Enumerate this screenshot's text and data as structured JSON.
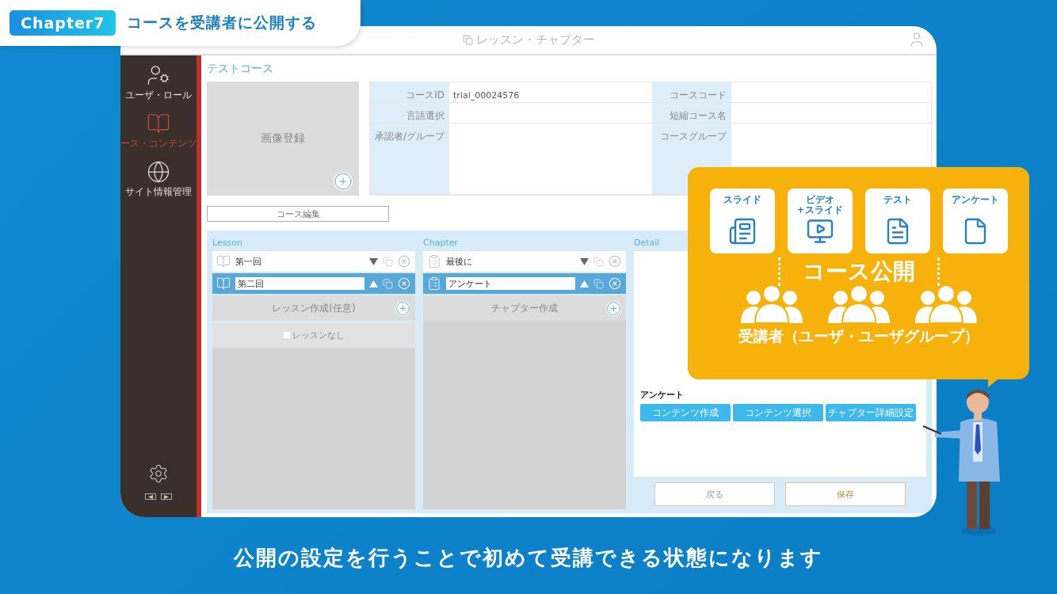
{
  "header": {
    "chapter_badge": "Chapter7",
    "title": "コースを受講者に公開する"
  },
  "window": {
    "title": "レッスン・チャプター"
  },
  "sidebar": {
    "items": [
      {
        "label": "ユーザ・ロール",
        "selected": false
      },
      {
        "label": "ース・コンテンツ",
        "selected": true
      },
      {
        "label": "サイト情報管理",
        "selected": false
      }
    ]
  },
  "course": {
    "title": "テストコース",
    "image_label": "画像登録",
    "fields": [
      {
        "label": "コースID",
        "value": "trial_00024576"
      },
      {
        "label": "コースコード"
      },
      {
        "label": "言語選択"
      },
      {
        "label": "短縮コース名"
      },
      {
        "label": "承認者/グループ"
      },
      {
        "label": "コースグループ"
      }
    ],
    "edit_button": "コース編集"
  },
  "lesson": {
    "heading": "Lesson",
    "items": [
      {
        "name": "第一回",
        "selected": false
      },
      {
        "name": "第二回",
        "selected": true
      }
    ],
    "create_label": "レッスン作成(任意)",
    "none_option": {
      "label": "レッスンなし",
      "checked": false
    }
  },
  "chapter": {
    "heading": "Chapter",
    "items": [
      {
        "name": "最後に",
        "selected": false
      },
      {
        "name": "アンケート",
        "selected": true
      }
    ],
    "create_label": "チャプター作成"
  },
  "detail": {
    "heading": "Detail",
    "section_label": "アンケート",
    "buttons": [
      "コンテンツ作成",
      "コンテンツ選択",
      "チャプター詳細設定"
    ]
  },
  "footer_buttons": [
    {
      "label": "戻る",
      "kind": "back"
    },
    {
      "label": "保存",
      "kind": "save"
    }
  ],
  "callout": {
    "content_types": [
      {
        "lines": [
          "スライド"
        ]
      },
      {
        "lines": [
          "ビデオ",
          "+スライド"
        ]
      },
      {
        "lines": [
          "テスト"
        ]
      },
      {
        "lines": [
          "アンケート"
        ]
      }
    ],
    "publish_label": "コース公開",
    "audience_label": "受講者（ユーザ・ユーザグループ）"
  },
  "caption": "公開の設定を行うことで初めて受講できる状態になります"
}
